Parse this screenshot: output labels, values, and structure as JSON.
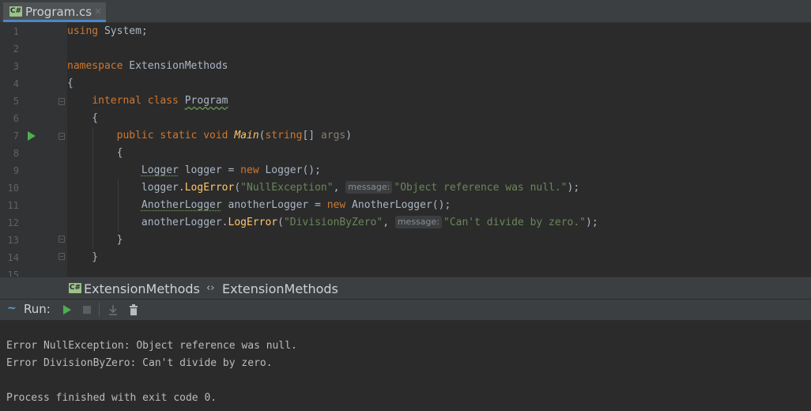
{
  "tab": {
    "icon": "csharp-file-icon",
    "icon_text": "C#",
    "title": "Program.cs",
    "close": "×"
  },
  "gutter": {
    "line_numbers": [
      "1",
      "2",
      "3",
      "4",
      "5",
      "6",
      "7",
      "8",
      "9",
      "10",
      "11",
      "12",
      "13",
      "14",
      "15"
    ]
  },
  "code": {
    "l1": {
      "kw": "using",
      "rest": " System;"
    },
    "l3": {
      "kw": "namespace",
      "rest": " ExtensionMethods"
    },
    "l4": "{",
    "l5": {
      "indent": "    ",
      "kw": "internal class",
      "sp": " ",
      "name": "Program"
    },
    "l6": "    {",
    "l7": {
      "indent": "        ",
      "kw": "public static void",
      "sp": " ",
      "name": "Main",
      "paren_open": "(",
      "type": "string",
      "rest": "[] ",
      "param": "args",
      "paren_close": ")"
    },
    "l8": "        {",
    "l9": {
      "indent": "            ",
      "type": "Logger",
      "mid": " logger = ",
      "kw": "new",
      "rest": " Logger();"
    },
    "l10": {
      "indent": "            ",
      "obj": "logger.",
      "method": "LogError",
      "open": "(",
      "s1": "\"NullException\"",
      "comma": ", ",
      "hint": "message:",
      "s2": "\"Object reference was null.\"",
      "close": ");"
    },
    "l11": {
      "indent": "            ",
      "type": "AnotherLogger",
      "mid": " anotherLogger = ",
      "kw": "new",
      "rest": " AnotherLogger();"
    },
    "l12": {
      "indent": "            ",
      "obj": "anotherLogger.",
      "method": "LogError",
      "open": "(",
      "s1": "\"DivisionByZero\"",
      "comma": ", ",
      "hint": "message:",
      "s2": "\"Can't divide by zero.\"",
      "close": ");"
    },
    "l13": "        }",
    "l14": "    }"
  },
  "breadcrumb": {
    "class_icon_text": "C#",
    "class_label": "ExtensionMethods",
    "namespace_icon": "‹›",
    "namespace_label": "ExtensionMethods"
  },
  "run_panel": {
    "label": "Run:",
    "output": [
      "Error NullException: Object reference was null.",
      "Error DivisionByZero: Can't divide by zero.",
      "",
      "Process finished with exit code 0."
    ]
  },
  "colors": {
    "keyword": "#cc7832",
    "string": "#6a8759",
    "method": "#ffc66d",
    "run_green": "#4fae4f",
    "tab_underline": "#4a88c7"
  }
}
